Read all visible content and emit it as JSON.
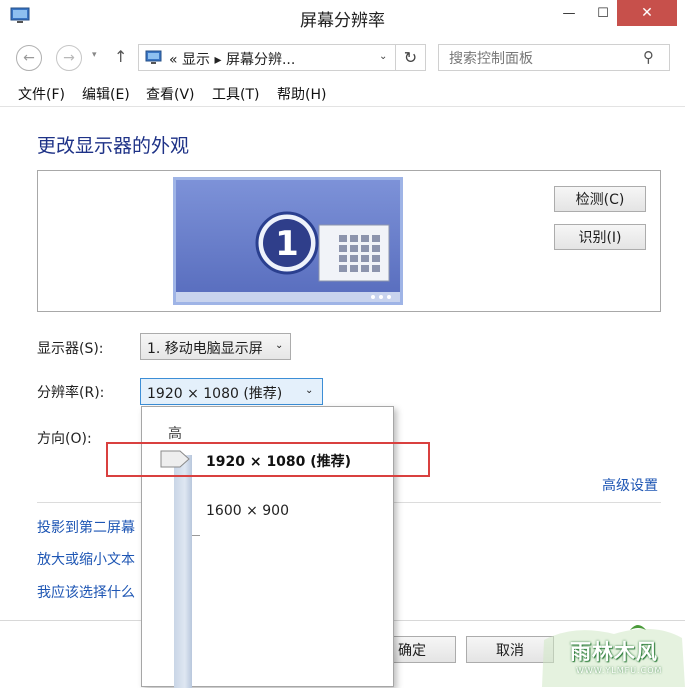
{
  "window": {
    "title": "屏幕分辨率",
    "minimize": "—",
    "maximize": "☐",
    "close": "✕"
  },
  "nav": {
    "back": "←",
    "forward": "→",
    "recent": "▾",
    "up": "↑",
    "address_text": "« 显示 ▸ 屏幕分辨...",
    "address_dropdown": "⌄",
    "refresh": "↻",
    "search_placeholder": "搜索控制面板",
    "search_icon": "⚲"
  },
  "menu": [
    "文件(F)",
    "编辑(E)",
    "查看(V)",
    "工具(T)",
    "帮助(H)"
  ],
  "main": {
    "title": "更改显示器的外观",
    "detect_label": "检测(C)",
    "identify_label": "识别(I)",
    "monitor_number": "1",
    "display_label": "显示器(S):",
    "display_value": "1. 移动电脑显示屏",
    "resolution_label": "分辨率(R):",
    "resolution_value": "1920 × 1080 (推荐)",
    "orientation_label": "方向(O):",
    "advanced_link": "高级设置",
    "links": [
      "投影到第二屏幕",
      "放大或缩小文本",
      "我应该选择什么"
    ],
    "ok_label": "确定",
    "cancel_label": "取消",
    "chevron": "⌄"
  },
  "dropdown": {
    "high_label": "高",
    "options": [
      "1920 × 1080 (推荐)",
      "1600 × 900"
    ],
    "selected_index": 0
  },
  "watermark": {
    "text": "雨林木风",
    "url": "WWW.YLMFU.COM"
  },
  "colors": {
    "accent_title": "#1e3287",
    "link": "#1e56b4",
    "highlight": "#d9403f",
    "close_button": "#c7504b"
  }
}
